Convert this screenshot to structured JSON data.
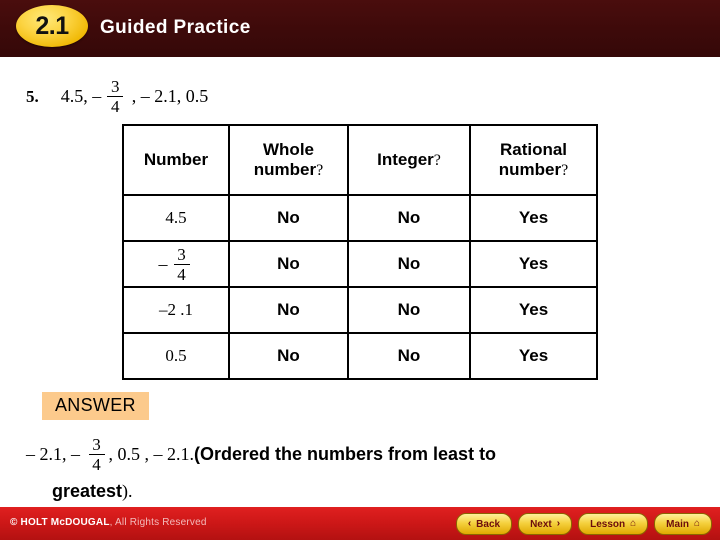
{
  "header": {
    "chapter_badge": "2.1",
    "title": "Guided Practice",
    "bg_color": "#3d0a0a",
    "badge_color": "#fcd443"
  },
  "problem": {
    "number": "5.",
    "prefix": "4.5, ",
    "minus": "–",
    "fraction": {
      "numerator": "3",
      "denominator": "4"
    },
    "suffix": " , – 2.1, 0.5"
  },
  "table": {
    "headers": [
      {
        "label": "Number",
        "question_mark": ""
      },
      {
        "label": "Whole number",
        "question_mark": "?"
      },
      {
        "label": "Integer",
        "question_mark": "?"
      },
      {
        "label": "Rational number",
        "question_mark": "?"
      }
    ],
    "rows": [
      {
        "number": "4.5",
        "is_fraction": false,
        "whole": "No",
        "integer": "No",
        "rational": "Yes"
      },
      {
        "number": "– 3/4",
        "is_fraction": true,
        "minus": "–",
        "numerator": "3",
        "denominator": "4",
        "whole": "No",
        "integer": "No",
        "rational": "Yes"
      },
      {
        "number": "–2 .1",
        "is_fraction": false,
        "whole": "No",
        "integer": "No",
        "rational": "Yes"
      },
      {
        "number": "0.5",
        "is_fraction": false,
        "whole": "No",
        "integer": "No",
        "rational": "Yes"
      }
    ]
  },
  "answer": {
    "badge_label": "ANSWER",
    "badge_color": "#fcca8c",
    "part1": "– 2.1, – ",
    "fraction": {
      "numerator": "3",
      "denominator": "4"
    },
    "part2": ", 0.5 , – 2.1.",
    "explanation": "(Ordered the numbers from least to",
    "explanation_line2": "greatest",
    "explanation_tail": ")."
  },
  "footer": {
    "copyright_brand": "© HOLT McDOUGAL",
    "copyright_rest": ", All Rights Reserved",
    "bg_color": "#cc1717",
    "buttons": [
      {
        "label": "Back",
        "glyph": "‹",
        "glyph_position": "before",
        "icon_name": "chevron-left-icon"
      },
      {
        "label": "Next",
        "glyph": "›",
        "glyph_position": "after",
        "icon_name": "chevron-right-icon"
      },
      {
        "label": "Lesson",
        "glyph": "⌂",
        "glyph_position": "after",
        "icon_name": "home-icon"
      },
      {
        "label": "Main",
        "glyph": "⌂",
        "glyph_position": "after",
        "icon_name": "home-icon"
      }
    ]
  }
}
